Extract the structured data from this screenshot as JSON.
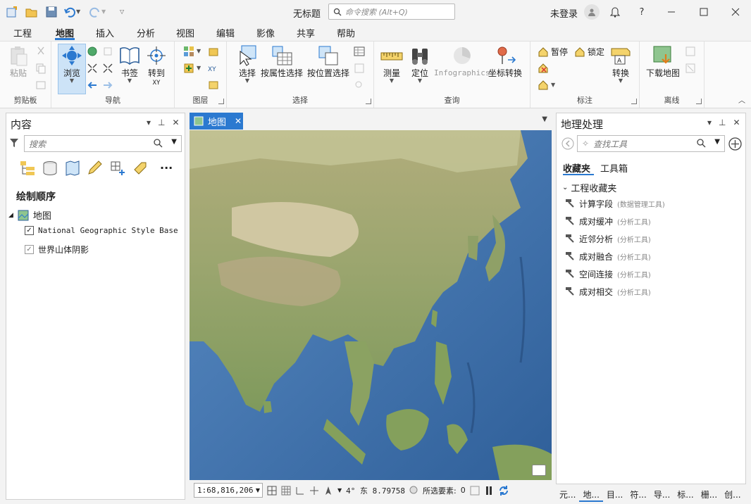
{
  "window": {
    "title": "无标题",
    "search_placeholder": "命令搜索 (Alt+Q)",
    "user": "未登录"
  },
  "ribbon_tabs": [
    "工程",
    "地图",
    "插入",
    "分析",
    "视图",
    "编辑",
    "影像",
    "共享",
    "帮助"
  ],
  "active_ribbon_tab": "地图",
  "ribbon": {
    "clipboard": {
      "label": "剪贴板",
      "paste": "粘贴"
    },
    "navigate": {
      "label": "导航",
      "explore": "浏览",
      "bookmarks": "书签",
      "goto": "转到",
      "goto_sub": "XY"
    },
    "layer": {
      "label": "图层"
    },
    "selection": {
      "label": "选择",
      "select": "选择",
      "by_attr": "按属性选择",
      "by_loc": "按位置选择"
    },
    "inquiry": {
      "label": "查询",
      "measure": "测量",
      "locate": "定位",
      "infographics": "Infographics",
      "convert_coords": "坐标转换"
    },
    "labeling": {
      "label": "标注",
      "pause": "暂停",
      "lock": "锁定",
      "convert": "转换"
    },
    "offline": {
      "label": "离线",
      "download": "下载地图"
    }
  },
  "contents": {
    "title": "内容",
    "search_placeholder": "搜索",
    "drawing_order": "绘制顺序",
    "map_name": "地图",
    "layers": [
      {
        "name": "National Geographic Style Base",
        "checked": true
      },
      {
        "name": "世界山体阴影",
        "checked": true
      }
    ]
  },
  "map_view": {
    "tab_label": "地图",
    "scale": "1:68,816,206",
    "coords": "4° 东 8.79758",
    "selected": "所选要素:",
    "selected_count": "0"
  },
  "geoprocessing": {
    "title": "地理处理",
    "search_placeholder": "查找工具",
    "subtabs": [
      "收藏夹",
      "工具箱"
    ],
    "section": "工程收藏夹",
    "tools": [
      {
        "name": "计算字段",
        "toolbox": "(数据管理工具)"
      },
      {
        "name": "成对缓冲",
        "toolbox": "(分析工具)"
      },
      {
        "name": "近邻分析",
        "toolbox": "(分析工具)"
      },
      {
        "name": "成对融合",
        "toolbox": "(分析工具)"
      },
      {
        "name": "空间连接",
        "toolbox": "(分析工具)"
      },
      {
        "name": "成对相交",
        "toolbox": "(分析工具)"
      }
    ]
  },
  "bottom_tabs": [
    "元...",
    "地...",
    "目...",
    "符...",
    "导...",
    "标...",
    "栅...",
    "创..."
  ],
  "active_bottom_tab": "地...",
  "colors": {
    "accent": "#2b79d0",
    "ocean": "#3e6fa8",
    "land": "#9aa56e"
  }
}
